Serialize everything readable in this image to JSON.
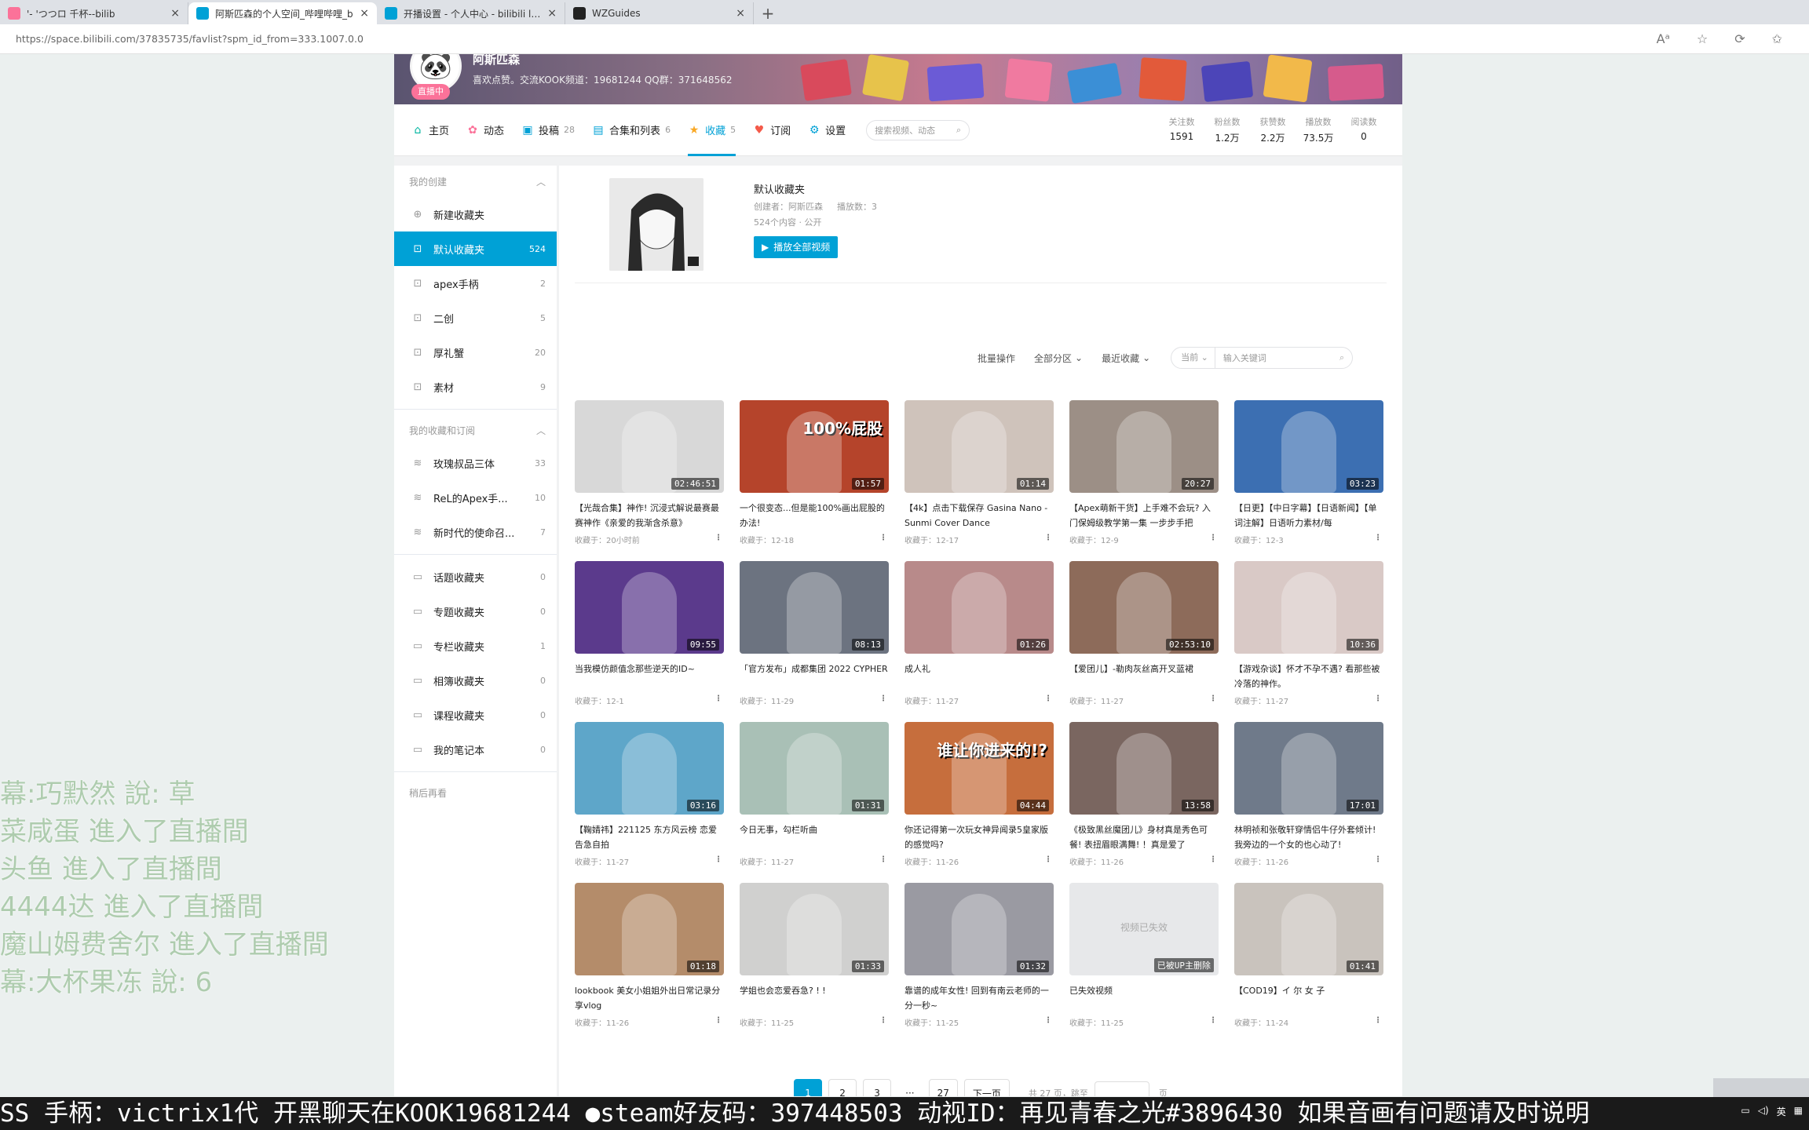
{
  "browser": {
    "tabs": [
      {
        "title": "'- 'つつロ 千杯--bilib",
        "fav_color": "#fb7299",
        "active": false
      },
      {
        "title": "阿斯匹森的个人空间_哔哩哔哩_b",
        "fav_color": "#00a1d6",
        "active": true
      },
      {
        "title": "开播设置 - 个人中心 - bilibili link",
        "fav_color": "#00a1d6",
        "active": false
      },
      {
        "title": "WZGuides",
        "fav_color": "#222222",
        "active": false
      }
    ],
    "url": "https://space.bilibili.com/37835735/favlist?spm_id_from=333.1007.0.0"
  },
  "banner": {
    "name": "阿斯匹森",
    "signature": "喜欢点赞。交流KOOK频道：19681244  QQ群：371648562",
    "live_badge": "直播中"
  },
  "nav": {
    "items": [
      {
        "label": "主页",
        "count": "",
        "icon": "home-icon",
        "glyph": "⌂",
        "color": "#00b5a0"
      },
      {
        "label": "动态",
        "count": "",
        "icon": "dynamic-icon",
        "glyph": "✿",
        "color": "#fb7299"
      },
      {
        "label": "投稿",
        "count": "28",
        "icon": "upload-icon",
        "glyph": "▣",
        "color": "#00a1d6"
      },
      {
        "label": "合集和列表",
        "count": "6",
        "icon": "collection-icon",
        "glyph": "▤",
        "color": "#00a1d6"
      },
      {
        "label": "收藏",
        "count": "5",
        "icon": "favorite-icon",
        "glyph": "★",
        "color": "#f9a825",
        "active": true
      },
      {
        "label": "订阅",
        "count": "",
        "icon": "subscribe-icon",
        "glyph": "♥",
        "color": "#f45a4a"
      },
      {
        "label": "设置",
        "count": "",
        "icon": "settings-icon",
        "glyph": "⚙",
        "color": "#00a1d6"
      }
    ],
    "search_placeholder": "搜索视频、动态",
    "stats": [
      {
        "label": "关注数",
        "value": "1591"
      },
      {
        "label": "粉丝数",
        "value": "1.2万"
      },
      {
        "label": "获赞数",
        "value": "2.2万"
      },
      {
        "label": "播放数",
        "value": "73.5万"
      },
      {
        "label": "阅读数",
        "value": "0"
      }
    ]
  },
  "sidebar": {
    "my_created_header": "我的创建",
    "new_folder": "新建收藏夹",
    "created": [
      {
        "name": "默认收藏夹",
        "count": "524",
        "active": true
      },
      {
        "name": "apex手柄",
        "count": "2"
      },
      {
        "name": "二创",
        "count": "5"
      },
      {
        "name": "厚礼蟹",
        "count": "20"
      },
      {
        "name": "素材",
        "count": "9"
      }
    ],
    "subscribed_header": "我的收藏和订阅",
    "subscribed": [
      {
        "name": "玫瑰叔品三体",
        "count": "33"
      },
      {
        "name": "ReL的Apex手...",
        "count": "10"
      },
      {
        "name": "新时代的使命召...",
        "count": "7"
      }
    ],
    "others": [
      {
        "name": "话题收藏夹",
        "count": "0"
      },
      {
        "name": "专题收藏夹",
        "count": "0"
      },
      {
        "name": "专栏收藏夹",
        "count": "1"
      },
      {
        "name": "相簿收藏夹",
        "count": "0"
      },
      {
        "name": "课程收藏夹",
        "count": "0"
      },
      {
        "name": "我的笔记本",
        "count": "0"
      }
    ],
    "watch_later": "稍后再看"
  },
  "favorite": {
    "title": "默认收藏夹",
    "creator": "创建者：阿斯匹森",
    "plays": "播放数：3",
    "meta": "524个内容 · 公开",
    "play_all": "播放全部视频"
  },
  "filter": {
    "batch": "批量操作",
    "zone": "全部分区",
    "sort": "最近收藏",
    "scope": "当前",
    "keyword_placeholder": "输入关键词"
  },
  "videos": [
    {
      "title": "【光哉合集】神作! 沉浸式解说最赛最赛神作《亲爱的我渐含杀意》",
      "date": "收藏于：20小时前",
      "dur": "02:46:51",
      "bg": "#d8d8d8"
    },
    {
      "title": "一个很变态...但是能100%画出屁股的办法!",
      "date": "收藏于：12-18",
      "dur": "01:57",
      "bg": "#b5442b",
      "overlay": "100%屁股"
    },
    {
      "title": "【4k】点击下载保存 Gasina Nano - Sunmi Cover Dance",
      "date": "收藏于：12-17",
      "dur": "01:14",
      "bg": "#cfc3bb"
    },
    {
      "title": "【Apex萌新干货】上手难不会玩? 入门保姆级教学第一集 一步步手把",
      "date": "收藏于：12-9",
      "dur": "20:27",
      "bg": "#9c8f86"
    },
    {
      "title": "【日更】【中日字幕】【日语新闻】【单词注解】日语听力素材/每",
      "date": "收藏于：12-3",
      "dur": "03:23",
      "bg": "#3c6fb2"
    },
    {
      "title": "当我模仿颜值念那些逆天的ID~",
      "date": "收藏于：12-1",
      "dur": "09:55",
      "bg": "#5b3a8c"
    },
    {
      "title": "「官方发布」成都集团 2022 CYPHER",
      "date": "收藏于：11-29",
      "dur": "08:13",
      "bg": "#6c7380"
    },
    {
      "title": "成人礼",
      "date": "收藏于：11-27",
      "dur": "01:26",
      "bg": "#b88a8a"
    },
    {
      "title": "【爱团儿】-勒肉灰丝高开叉蓝裙",
      "date": "收藏于：11-27",
      "dur": "02:53:10",
      "bg": "#8d6b5a"
    },
    {
      "title": "【游戏杂谈】怀才不孕不遇? 看那些被冷落的神作。",
      "date": "收藏于：11-27",
      "dur": "10:36",
      "bg": "#d9c9c6"
    },
    {
      "title": "【鞠婧祎】221125 东方风云榜 恋爱告急自拍",
      "date": "收藏于：11-27",
      "dur": "03:16",
      "bg": "#5ea6c9"
    },
    {
      "title": "今日无事，勾栏听曲",
      "date": "收藏于：11-27",
      "dur": "01:31",
      "bg": "#a9c0b6"
    },
    {
      "title": "你还记得第一次玩女神异闻录5皇家版的感觉吗?",
      "date": "收藏于：11-26",
      "dur": "04:44",
      "bg": "#c66e3d",
      "overlay": "谁让你进来的!?"
    },
    {
      "title": "《极致黑丝魔团儿》身材真是秀色可餐! 表扭眉眼满舞! ！真是爱了",
      "date": "收藏于：11-26",
      "dur": "13:58",
      "bg": "#7a6660"
    },
    {
      "title": "林明祯和张敬轩穿情侣牛仔外套倾计! 我旁边的一个女的也心动了!",
      "date": "收藏于：11-26",
      "dur": "17:01",
      "bg": "#6f7a8a"
    },
    {
      "title": "lookbook 美女小姐姐外出日常记录分享vlog",
      "date": "收藏于：11-26",
      "dur": "01:18",
      "bg": "#b48c6a"
    },
    {
      "title": "学姐也会恋爱吞急? ! !",
      "date": "收藏于：11-25",
      "dur": "01:33",
      "bg": "#d0d0cf"
    },
    {
      "title": "靠谱的成年女性! 回到有南云老师的一分一秒~",
      "date": "收藏于：11-25",
      "dur": "01:32",
      "bg": "#9a9aa2"
    },
    {
      "title": "已失效视频",
      "date": "收藏于：11-25",
      "dur": "已被UP主删除",
      "bg": "#e7e8ea",
      "invalid": "视频已失效"
    },
    {
      "title": "【COD19】イ 尔 女 子",
      "date": "收藏于：11-24",
      "dur": "01:41",
      "bg": "#c9c3bd"
    }
  ],
  "pager": {
    "pages": [
      "1",
      "2",
      "3",
      "···",
      "27"
    ],
    "next": "下一页",
    "info": "共 27 页，跳至",
    "unit": "页"
  },
  "danmaku": [
    "幕:巧默然 說: 草",
    "菜咸蛋 進入了直播間",
    "头鱼 進入了直播間",
    "4444达 進入了直播間",
    "魔山姆费舍尔 進入了直播間",
    "幕:大杯果冻 說: 6"
  ],
  "ticker": "SS 手柄：victrix1代 开黑聊天在KOOK19681244 ●steam好友码：397448503 动视ID：再见青春之光#3896430  如果音画有问题请及时说明"
}
